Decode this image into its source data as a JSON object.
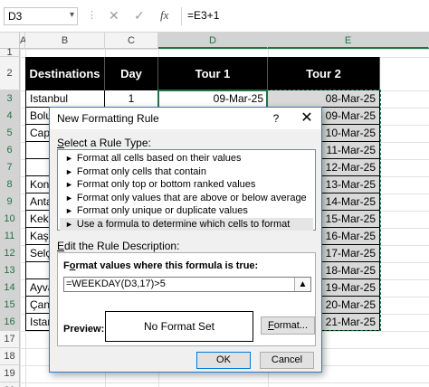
{
  "formula_bar": {
    "name_box": "D3",
    "formula": "=E3+1",
    "cancel_icon": "✕",
    "enter_icon": "✓",
    "fx_icon": "fx"
  },
  "sheet": {
    "columns": [
      "A",
      "B",
      "C",
      "D",
      "E"
    ],
    "rows": [
      "1",
      "2",
      "3",
      "4",
      "5",
      "6",
      "7",
      "8",
      "9",
      "10",
      "11",
      "12",
      "13",
      "14",
      "15",
      "16",
      "17",
      "18",
      "19",
      "20"
    ],
    "headers": {
      "destinations": "Destinations",
      "day": "Day",
      "tour1": "Tour 1",
      "tour2": "Tour 2"
    },
    "b_values": [
      "Istanbul",
      "Bolu",
      "Capp",
      "",
      "",
      "Kony",
      "Anta",
      "Keko",
      "Kaş",
      "Selç",
      "",
      "Ayva",
      "Çana",
      "Istan"
    ],
    "c_values": [
      "1"
    ],
    "d_values": [
      "09-Mar-25"
    ],
    "e_values": [
      "08-Mar-25",
      "09-Mar-25",
      "10-Mar-25",
      "11-Mar-25",
      "12-Mar-25",
      "13-Mar-25",
      "14-Mar-25",
      "15-Mar-25",
      "16-Mar-25",
      "17-Mar-25",
      "18-Mar-25",
      "19-Mar-25",
      "20-Mar-25",
      "21-Mar-25"
    ]
  },
  "dialog": {
    "title": "New Formatting Rule",
    "help": "?",
    "close": "✕",
    "select_rule_label_u": "S",
    "select_rule_label_rest": "elect a Rule Type:",
    "rule_types": [
      "Format all cells based on their values",
      "Format only cells that contain",
      "Format only top or bottom ranked values",
      "Format only values that are above or below average",
      "Format only unique or duplicate values",
      "Use a formula to determine which cells to format"
    ],
    "edit_label_u": "E",
    "edit_label_rest": "dit the Rule Description:",
    "formula_label_pre": "F",
    "formula_label_u": "o",
    "formula_label_rest": "rmat values where this formula is true:",
    "formula_value": "=WEEKDAY(D3,17)>5",
    "preview_label": "Preview:",
    "preview_text": "No Format Set",
    "format_btn_u": "F",
    "format_btn_rest": "ormat...",
    "ok": "OK",
    "cancel": "Cancel"
  }
}
